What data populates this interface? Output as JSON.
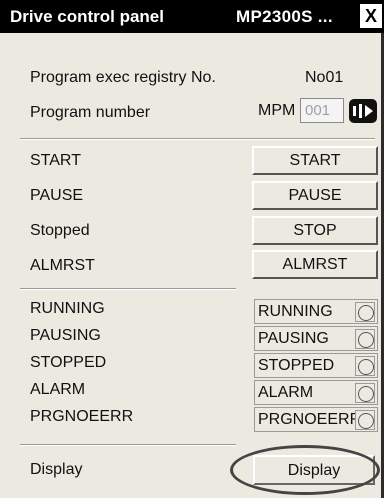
{
  "window": {
    "title": "Drive control panel",
    "subtitle": "MP2300S ...",
    "close_label": "X"
  },
  "info": {
    "registry_label": "Program exec registry No.",
    "registry_value": "No01",
    "program_label": "Program number",
    "program_prefix": "MPM",
    "program_value": "001",
    "program_button_icon": "ellipsis-select-icon"
  },
  "commands": [
    {
      "label": "START",
      "button": "START"
    },
    {
      "label": "PAUSE",
      "button": "PAUSE"
    },
    {
      "label": "Stopped",
      "button": "STOP"
    },
    {
      "label": "ALMRST",
      "button": "ALMRST"
    }
  ],
  "statuses": [
    {
      "label": "RUNNING",
      "indicator": "RUNNING"
    },
    {
      "label": "PAUSING",
      "indicator": "PAUSING"
    },
    {
      "label": "STOPPED",
      "indicator": "STOPPED"
    },
    {
      "label": "ALARM",
      "indicator": "ALARM"
    },
    {
      "label": "PRGNOEERR",
      "indicator": "PRGNOEERR"
    }
  ],
  "display": {
    "label": "Display",
    "button": "Display"
  },
  "colors": {
    "titlebar": "#000000",
    "panel": "#ece9e1",
    "highlight_oval": "#444444"
  }
}
